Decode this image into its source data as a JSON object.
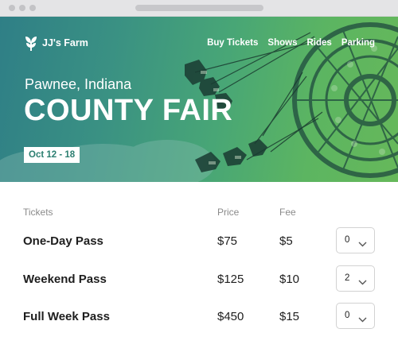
{
  "brand": {
    "name": "JJ's Farm",
    "icon": "sprout-icon"
  },
  "nav": [
    {
      "label": "Buy Tickets"
    },
    {
      "label": "Shows"
    },
    {
      "label": "Rides"
    },
    {
      "label": "Parking"
    }
  ],
  "hero": {
    "location": "Pawnee, Indiana",
    "title": "COUNTY FAIR",
    "dates": "Oct 12 - 18"
  },
  "tickets_table": {
    "headers": {
      "tickets": "Tickets",
      "price": "Price",
      "fee": "Fee"
    },
    "rows": [
      {
        "name": "One-Day Pass",
        "price": "$75",
        "fee": "$5",
        "quantity": "0"
      },
      {
        "name": "Weekend Pass",
        "price": "$125",
        "fee": "$10",
        "quantity": "2"
      },
      {
        "name": "Full Week Pass",
        "price": "$450",
        "fee": "$15",
        "quantity": "0"
      }
    ]
  },
  "colors": {
    "accent": "#2b7e70",
    "hero_start": "#2f7f86",
    "hero_end": "#66b85a"
  }
}
